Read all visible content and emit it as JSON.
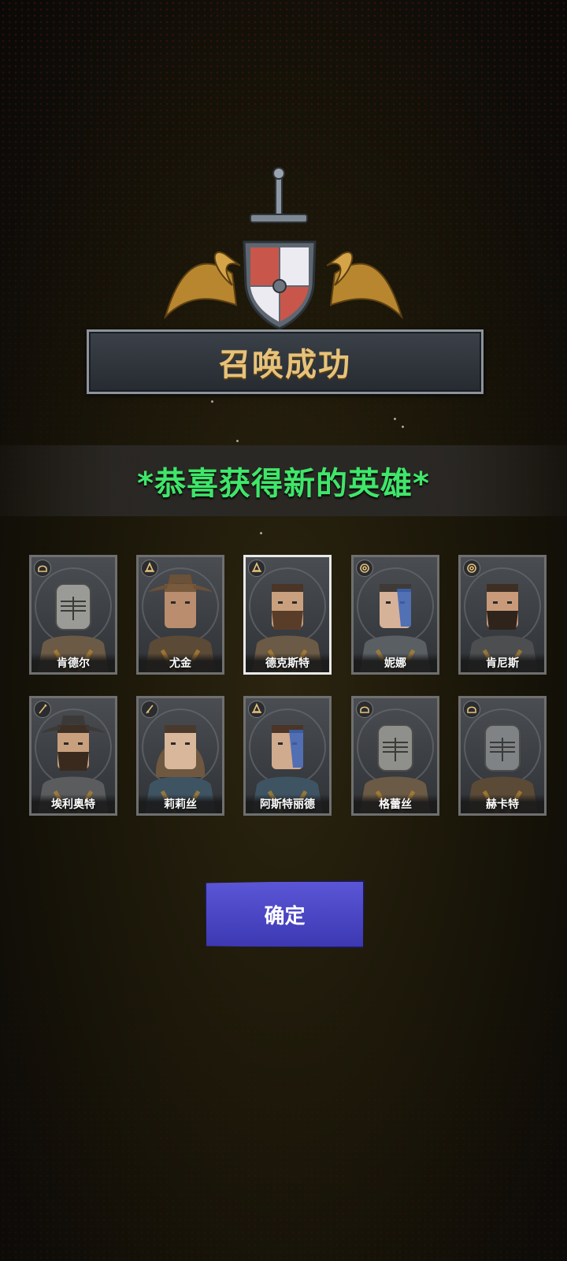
{
  "header": {
    "title": "召唤成功"
  },
  "banner": {
    "text": "*恭喜获得新的英雄*"
  },
  "heroes": [
    {
      "name": "肯德尔",
      "role_icon": "helmet-icon",
      "selected": false,
      "palette": "knight"
    },
    {
      "name": "尤金",
      "role_icon": "wizard-hat-icon",
      "selected": false,
      "palette": "hat"
    },
    {
      "name": "德克斯特",
      "role_icon": "wizard-hat-icon",
      "selected": true,
      "palette": "warrior"
    },
    {
      "name": "妮娜",
      "role_icon": "target-icon",
      "selected": false,
      "palette": "blue"
    },
    {
      "name": "肯尼斯",
      "role_icon": "target-icon",
      "selected": false,
      "palette": "mustache"
    },
    {
      "name": "埃利奥特",
      "role_icon": "staff-icon",
      "selected": false,
      "palette": "cowboy"
    },
    {
      "name": "莉莉丝",
      "role_icon": "dagger-icon",
      "selected": false,
      "palette": "hood"
    },
    {
      "name": "阿斯特丽德",
      "role_icon": "wizard-hat-icon",
      "selected": false,
      "palette": "warrior2"
    },
    {
      "name": "格蕾丝",
      "role_icon": "helmet-icon",
      "selected": false,
      "palette": "knight2"
    },
    {
      "name": "赫卡特",
      "role_icon": "helmet-icon",
      "selected": false,
      "palette": "knight3"
    }
  ],
  "confirm_button": {
    "label": "确定"
  },
  "colors": {
    "title": "#e7c27a",
    "banner_text": "#3fe66a",
    "button": "#4a46c6"
  }
}
